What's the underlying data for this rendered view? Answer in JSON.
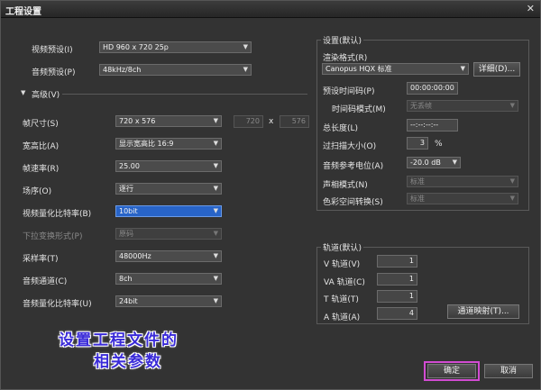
{
  "window": {
    "title": "工程设置",
    "close": "✕"
  },
  "left": {
    "video_preset": {
      "label": "视频预设(I)",
      "value": "HD 960 x 720 25p"
    },
    "audio_preset": {
      "label": "音频预设(P)",
      "value": "48kHz/8ch"
    },
    "advanced": {
      "label": "高级(V)"
    },
    "frame_size": {
      "label": "帧尺寸(S)",
      "value": "720 x 576",
      "w": "720",
      "x": "x",
      "h": "576"
    },
    "aspect": {
      "label": "宽高比(A)",
      "value": "显示宽高比 16:9"
    },
    "frame_rate": {
      "label": "帧速率(R)",
      "value": "25.00"
    },
    "field_order": {
      "label": "场序(O)",
      "value": "逐行"
    },
    "video_bit": {
      "label": "视频量化比特率(B)",
      "value": "10bit"
    },
    "pulldown": {
      "label": "下拉变换形式(P)",
      "value": "原码"
    },
    "sample_rate": {
      "label": "采样率(T)",
      "value": "48000Hz"
    },
    "audio_channels": {
      "label": "音频通道(C)",
      "value": "8ch"
    },
    "audio_bit": {
      "label": "音频量化比特率(U)",
      "value": "24bit"
    }
  },
  "settings": {
    "title": "设置(默认)",
    "render_format": {
      "label": "渲染格式(R)",
      "value": "Canopus HQX 标准",
      "detail": "详细(D)..."
    },
    "preset_timecode": {
      "label": "预设时间码(P)",
      "value": "00:00:00:00"
    },
    "timecode_mode": {
      "label": "时间码模式(M)",
      "value": "无丢帧"
    },
    "total_length": {
      "label": "总长度(L)",
      "value": "--:--:--:--"
    },
    "overscan": {
      "label": "过扫描大小(O)",
      "value": "3",
      "unit": "%"
    },
    "audio_ref": {
      "label": "音频参考电位(A)",
      "value": "-20.0 dB"
    },
    "phase_mode": {
      "label": "声相模式(N)",
      "value": "标准"
    },
    "color_space": {
      "label": "色彩空间转换(S)",
      "value": "标准"
    }
  },
  "tracks": {
    "title": "轨道(默认)",
    "v": {
      "label": "V 轨道(V)",
      "value": "1"
    },
    "va": {
      "label": "VA 轨道(C)",
      "value": "1"
    },
    "t": {
      "label": "T 轨道(T)",
      "value": "1"
    },
    "a": {
      "label": "A 轨道(A)",
      "value": "4"
    },
    "mapping": "通道映射(T)..."
  },
  "caption": {
    "line1": "设置工程文件的",
    "line2": "相关参数"
  },
  "buttons": {
    "ok": "确定",
    "cancel": "取消"
  }
}
